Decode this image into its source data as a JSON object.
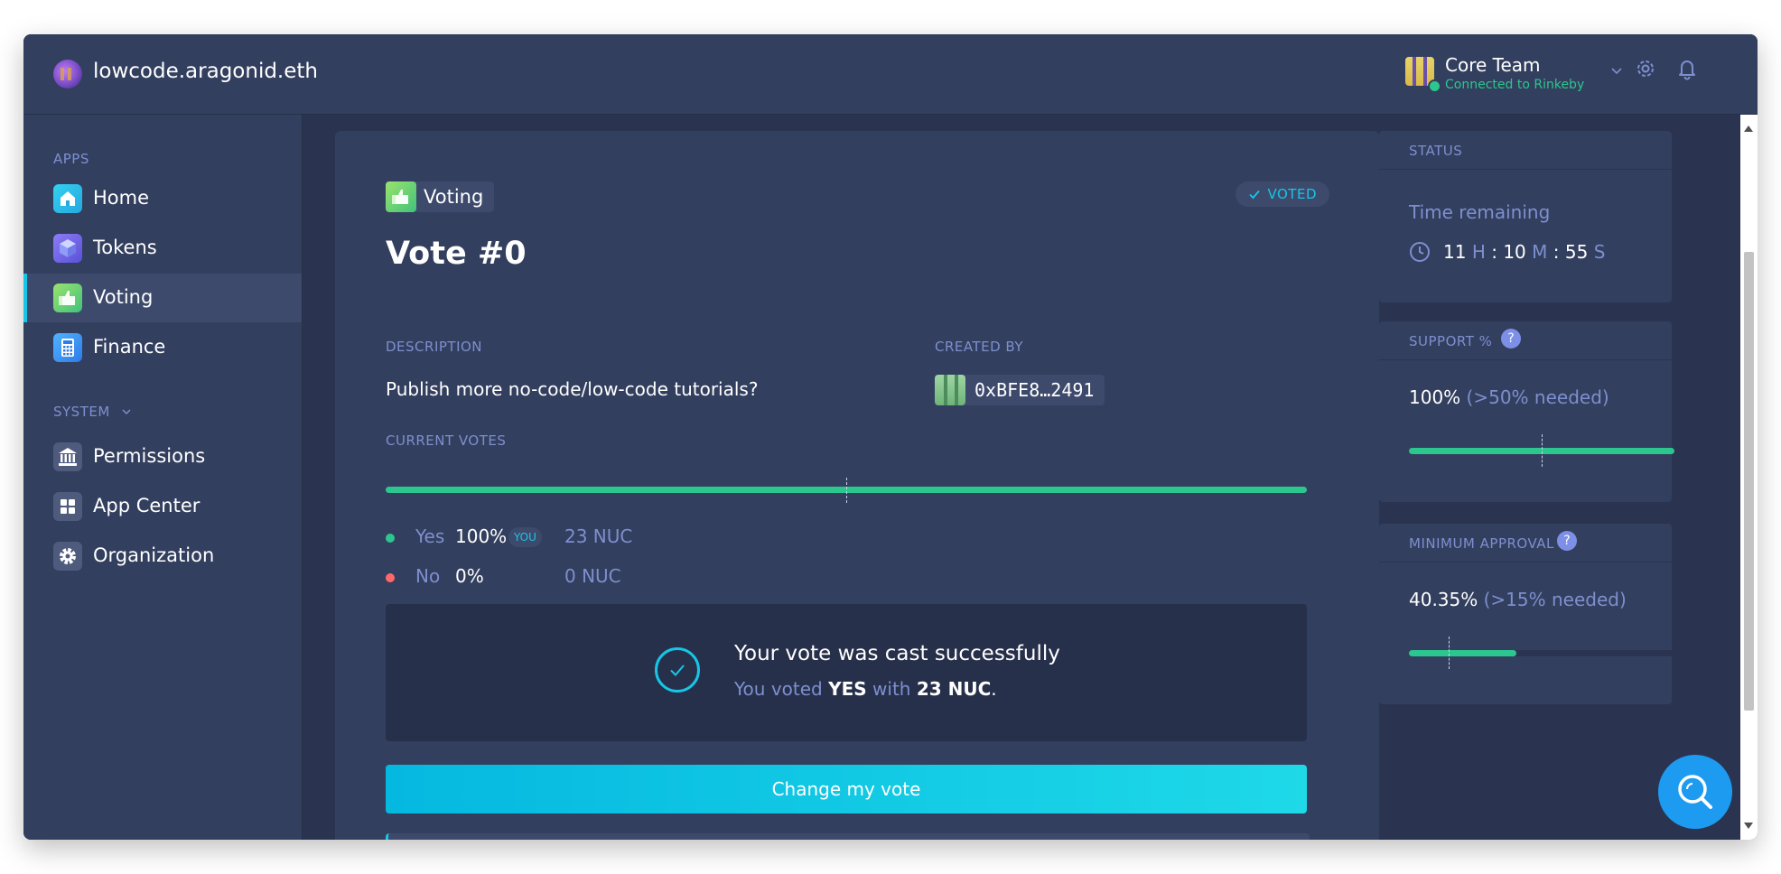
{
  "org": {
    "name": "lowcode.aragonid.eth"
  },
  "account": {
    "name": "Core Team",
    "network": "Connected to Rinkeby"
  },
  "sidebar": {
    "apps_label": "APPS",
    "system_label": "SYSTEM",
    "apps": [
      {
        "label": "Home",
        "icon": "home-icon"
      },
      {
        "label": "Tokens",
        "icon": "tokens-icon"
      },
      {
        "label": "Voting",
        "icon": "voting-icon",
        "active": true
      },
      {
        "label": "Finance",
        "icon": "calculator-icon"
      }
    ],
    "system": [
      {
        "label": "Permissions",
        "icon": "bank-icon"
      },
      {
        "label": "App Center",
        "icon": "grid-icon"
      },
      {
        "label": "Organization",
        "icon": "gear-icon"
      }
    ]
  },
  "vote": {
    "app_label": "Voting",
    "status_badge": "VOTED",
    "title": "Vote #0",
    "description_label": "DESCRIPTION",
    "description": "Publish more no-code/low-code tutorials?",
    "created_by_label": "CREATED BY",
    "creator": "0xBFE8…2491",
    "current_votes_label": "CURRENT VOTES",
    "yes_fraction": 1.0,
    "options": [
      {
        "label": "Yes",
        "percent": "100%",
        "amount": "23 NUC",
        "you": "YOU",
        "color": "#2cc68f"
      },
      {
        "label": "No",
        "percent": "0%",
        "amount": "0 NUC",
        "you": "",
        "color": "#ff6969"
      }
    ],
    "success": {
      "title": "Your vote was cast successfully",
      "sub_prefix": "You voted ",
      "choice": "YES",
      "sub_mid": " with ",
      "amount": "23 NUC",
      "sub_end": "."
    },
    "change_button": "Change my vote"
  },
  "status": {
    "title": "STATUS",
    "time_label": "Time remaining",
    "hours": "11",
    "hours_unit": "H",
    "minutes": "10",
    "minutes_unit": "M",
    "seconds": "55",
    "seconds_unit": "S",
    "sep": ":"
  },
  "support": {
    "title": "SUPPORT %",
    "value": "100%",
    "needed": "(>50% needed)",
    "fill_fraction": 1.0,
    "threshold_fraction": 0.5
  },
  "approval": {
    "title": "MINIMUM APPROVAL %",
    "value": "40.35%",
    "needed": "(>15% needed)",
    "fill_fraction": 0.4035,
    "threshold_fraction": 0.15
  },
  "colors": {
    "accent": "#17c6e6",
    "positive": "#2cc68f",
    "negative": "#ff6969",
    "help_fab": "#1d9bf0"
  }
}
